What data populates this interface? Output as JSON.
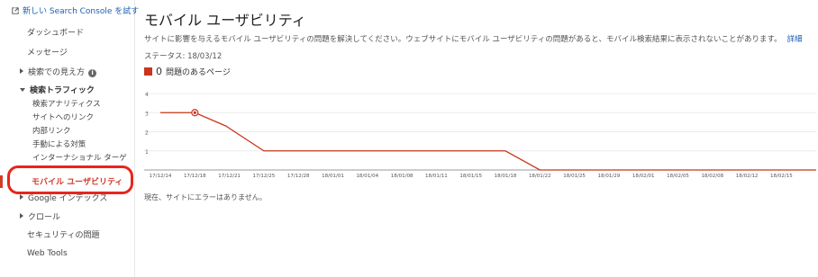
{
  "sidebar": {
    "new_console_link": "新しい Search Console を試す",
    "dashboard": "ダッシュボード",
    "messages": "メッセージ",
    "search_appearance": "検索での見え方",
    "search_traffic": "検索トラフィック",
    "search_traffic_items": [
      "検索アナリティクス",
      "サイトへのリンク",
      "内部リンク",
      "手動による対策",
      "インターナショナル ターゲ"
    ],
    "mobile_usability": "モバイル ユーザビリティ",
    "google_index": "Google インデックス",
    "crawl": "クロール",
    "security_issues": "セキュリティの問題",
    "web_tools": "Web Tools"
  },
  "main": {
    "title": "モバイル ユーザビリティ",
    "description": "サイトに影響を与えるモバイル ユーザビリティの問題を解決してください。ウェブサイトにモバイル ユーザビリティの問題があると、モバイル検索結果に表示されないことがあります。",
    "details_link": "詳細",
    "status_label": "ステータス: 18/03/12",
    "legend_count": "0",
    "legend_label": "問題のあるページ",
    "footer": "現在、サイトにエラーはありません。"
  },
  "colors": {
    "accent": "#c9351e",
    "highlight_border": "#e8251b",
    "link": "#1a5fb4"
  },
  "chart_data": {
    "type": "line",
    "categories": [
      "17/12/14",
      "17/12/18",
      "17/12/21",
      "17/12/25",
      "17/12/28",
      "18/01/01",
      "18/01/04",
      "18/01/08",
      "18/01/11",
      "18/01/15",
      "18/01/18",
      "18/01/22",
      "18/01/25",
      "18/01/29",
      "18/02/01",
      "18/02/05",
      "18/02/08",
      "18/02/12",
      "18/02/15"
    ],
    "series": [
      {
        "values": [
          3,
          3,
          2.3,
          1,
          1,
          1,
          1,
          1,
          1,
          1,
          1,
          0,
          0,
          0,
          0,
          0,
          0,
          0,
          0
        ]
      }
    ],
    "highlight_index": 1,
    "y_ticks": [
      1,
      2,
      3,
      4
    ],
    "ylim": [
      0,
      4
    ],
    "grid": true
  }
}
